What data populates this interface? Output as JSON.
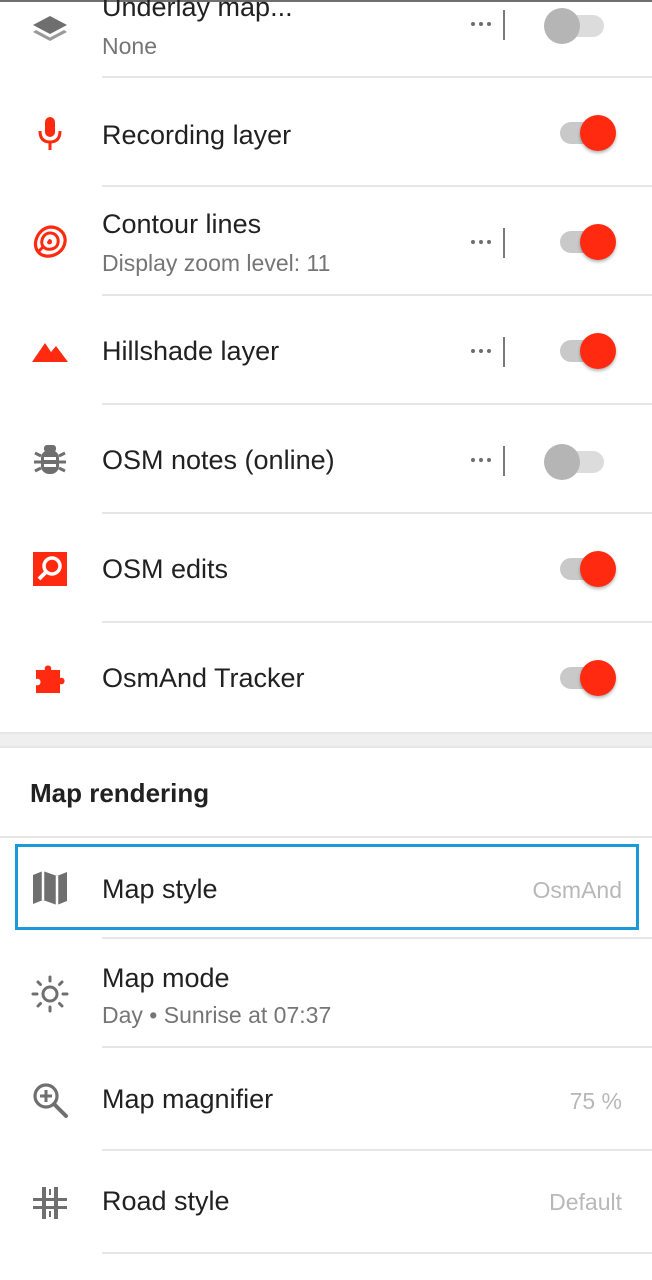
{
  "layers": {
    "items": [
      {
        "title": "Underlay map...",
        "subtitle": "None",
        "icon": "layers-icon",
        "toggle": false,
        "has_more": true
      },
      {
        "title": "Recording layer",
        "icon": "microphone-icon",
        "toggle": true,
        "has_more": false
      },
      {
        "title": "Contour lines",
        "subtitle": "Display zoom level: 11",
        "icon": "contour-lines-icon",
        "toggle": true,
        "has_more": true
      },
      {
        "title": "Hillshade layer",
        "icon": "mountains-icon",
        "toggle": true,
        "has_more": true
      },
      {
        "title": "OSM notes (online)",
        "icon": "bug-icon",
        "toggle": false,
        "has_more": true
      },
      {
        "title": "OSM edits",
        "icon": "osm-edit-icon",
        "toggle": true,
        "has_more": false
      },
      {
        "title": "OsmAnd Tracker",
        "icon": "puzzle-icon",
        "toggle": true,
        "has_more": false
      }
    ]
  },
  "map_rendering": {
    "section_title": "Map rendering",
    "items": [
      {
        "title": "Map style",
        "value": "OsmAnd",
        "icon": "map-icon",
        "selected": true
      },
      {
        "title": "Map mode",
        "subtitle": "Day • Sunrise at 07:37",
        "icon": "sun-icon"
      },
      {
        "title": "Map magnifier",
        "value": "75 %",
        "icon": "magnifier-plus-icon"
      },
      {
        "title": "Road style",
        "value": "Default",
        "icon": "road-icon"
      }
    ]
  },
  "colors": {
    "accent": "#ff2a0f",
    "selection": "#1a9bd7",
    "icon_gray": "#6f6f6f"
  }
}
